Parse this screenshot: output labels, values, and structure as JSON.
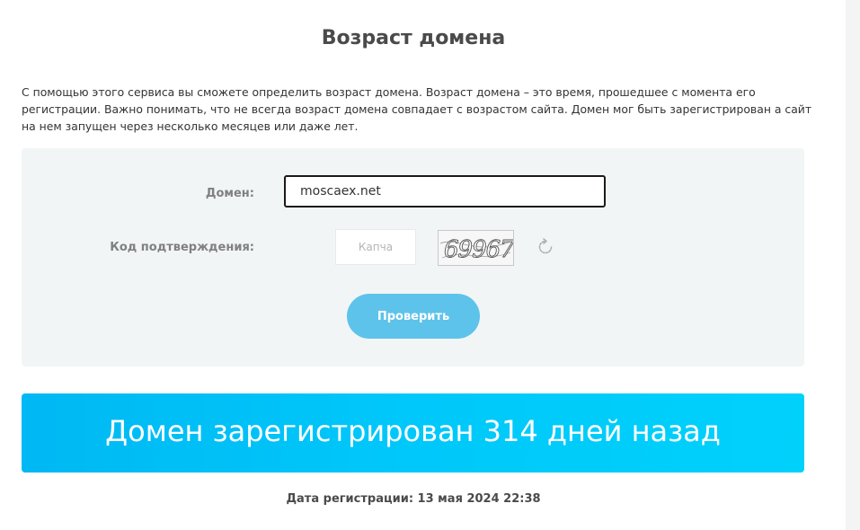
{
  "page": {
    "title": "Возраст домена",
    "intro": "С помощью этого сервиса вы сможете определить возраст домена. Возраст домена – это время, прошедшее с момента его регистрации. Важно понимать, что не всегда возраст домена совпадает с возрастом сайта. Домен мог быть зарегистрирован а сайт на нем запущен через несколько месяцев или даже лет."
  },
  "form": {
    "domain_label": "Домен:",
    "domain_value": "moscaex.net",
    "code_label": "Код подтверждения:",
    "captcha_placeholder": "Капча",
    "captcha_image_text": "69967",
    "refresh_icon": "refresh-icon",
    "submit_label": "Проверить"
  },
  "result": {
    "message": "Домен зарегистрирован 314 дней назад",
    "registration_date": "Дата регистрации: 13 мая 2024 22:38"
  },
  "colors": {
    "accent": "#5ec3ea",
    "banner": "#00c8fa",
    "panel": "#f2f5f6"
  }
}
